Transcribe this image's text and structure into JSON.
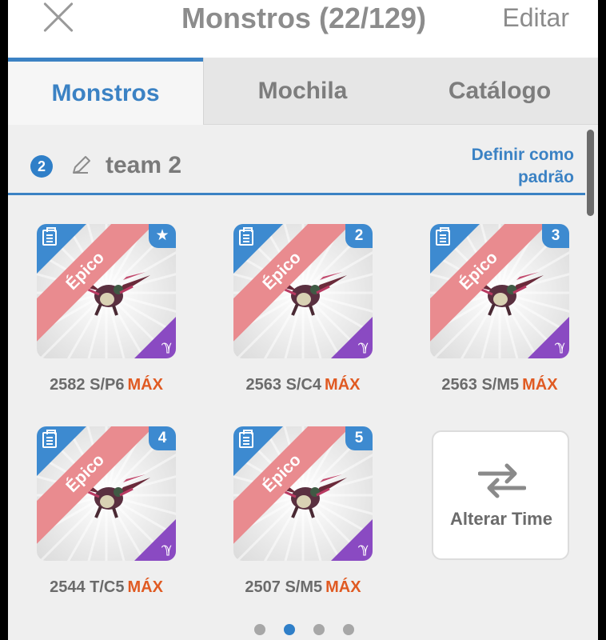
{
  "header": {
    "title": "Monstros (22/129)",
    "edit_label": "Editar"
  },
  "tabs": [
    {
      "label": "Monstros",
      "active": true
    },
    {
      "label": "Mochila",
      "active": false
    },
    {
      "label": "Catálogo",
      "active": false
    }
  ],
  "team": {
    "badge": "2",
    "name": "team 2",
    "set_default_label": "Definir como padrão"
  },
  "cards": [
    {
      "rarity": "Épico",
      "rank": "★",
      "power": "2582 S/P6",
      "max": "MÁX"
    },
    {
      "rarity": "Épico",
      "rank": "2",
      "power": "2563 S/C4",
      "max": "MÁX"
    },
    {
      "rarity": "Épico",
      "rank": "3",
      "power": "2563 S/M5",
      "max": "MÁX"
    },
    {
      "rarity": "Épico",
      "rank": "4",
      "power": "2544 T/C5",
      "max": "MÁX"
    },
    {
      "rarity": "Épico",
      "rank": "5",
      "power": "2507 S/M5",
      "max": "MÁX"
    }
  ],
  "switch_team": {
    "label": "Alterar Time",
    "icon": "swap-arrows-icon"
  },
  "pagination": {
    "total_pages": 4,
    "current_page": 2
  },
  "colors": {
    "accent": "#3b82c4",
    "rarity_ribbon": "#e98b8f",
    "max_label": "#e05a22",
    "type_corner": "#8a4ac2"
  }
}
